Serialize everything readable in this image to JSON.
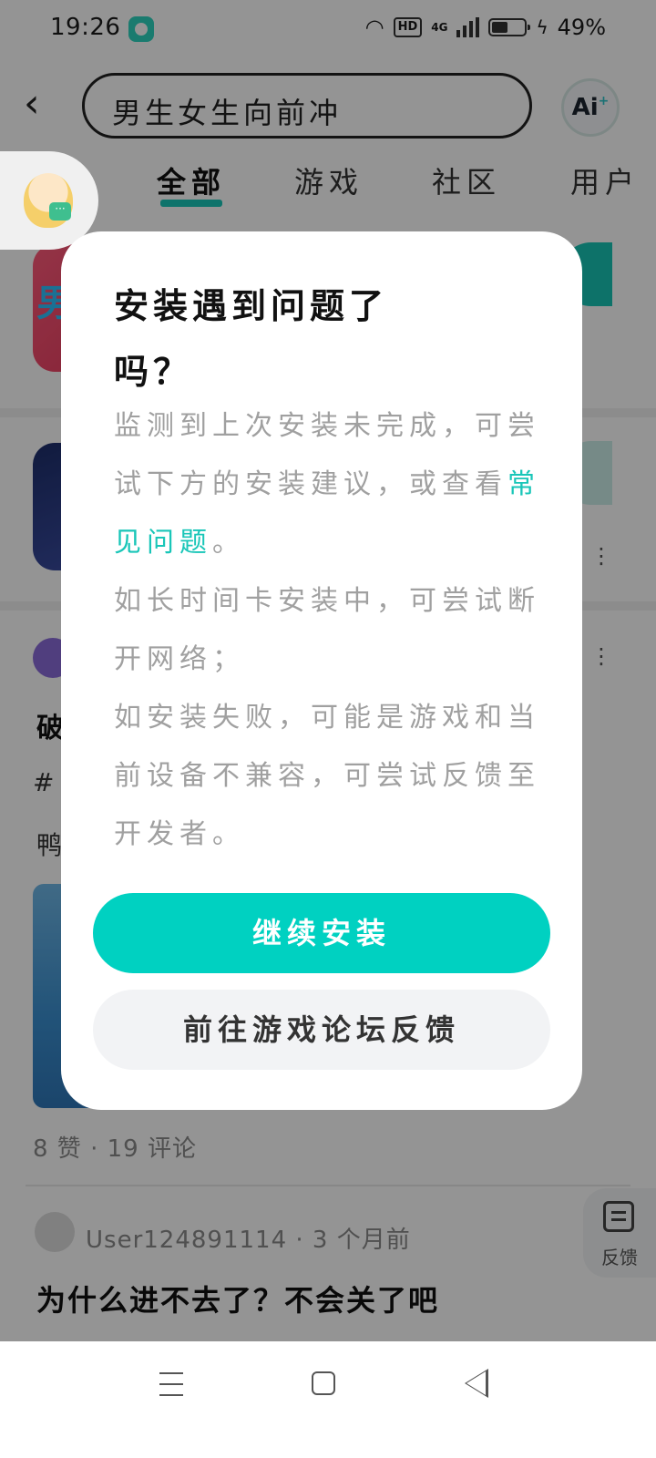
{
  "status_bar": {
    "time": "19:26",
    "hd": "HD",
    "network": "4G",
    "battery": "49%"
  },
  "header": {
    "search_query": "男生女生向前冲",
    "ai_label": "Ai",
    "ai_spark": "+"
  },
  "tabs": [
    {
      "label": "全部",
      "active": true
    },
    {
      "label": "游戏",
      "active": false
    },
    {
      "label": "社区",
      "active": false
    },
    {
      "label": "用户",
      "active": false
    }
  ],
  "feed": {
    "game1_icon_text": "男",
    "post_title_fragment": "破",
    "post_tag_fragment": "#",
    "post_text_fragment": "鸭",
    "post_stats": "8 赞 · 19 评论",
    "user_meta": "User124891114 · 3 个月前",
    "post2_title": "为什么进不去了？不会关了吧",
    "feedback_fab_label": "反馈"
  },
  "dialog": {
    "title": "安装遇到问题了吗？",
    "body_1": "监测到上次安装未完成，可尝试下方的安装建议，或查看",
    "link_text": "常见问题",
    "body_1_end": "。",
    "body_2": "如长时间卡安装中，可尝试断开网络；",
    "body_3": "如安装失败，可能是游戏和当前设备不兼容，可尝试反馈至开发者。",
    "primary_button": "继续安装",
    "secondary_button": "前往游戏论坛反馈"
  },
  "colors": {
    "accent": "#00d1c1",
    "link": "#19c6b8"
  }
}
